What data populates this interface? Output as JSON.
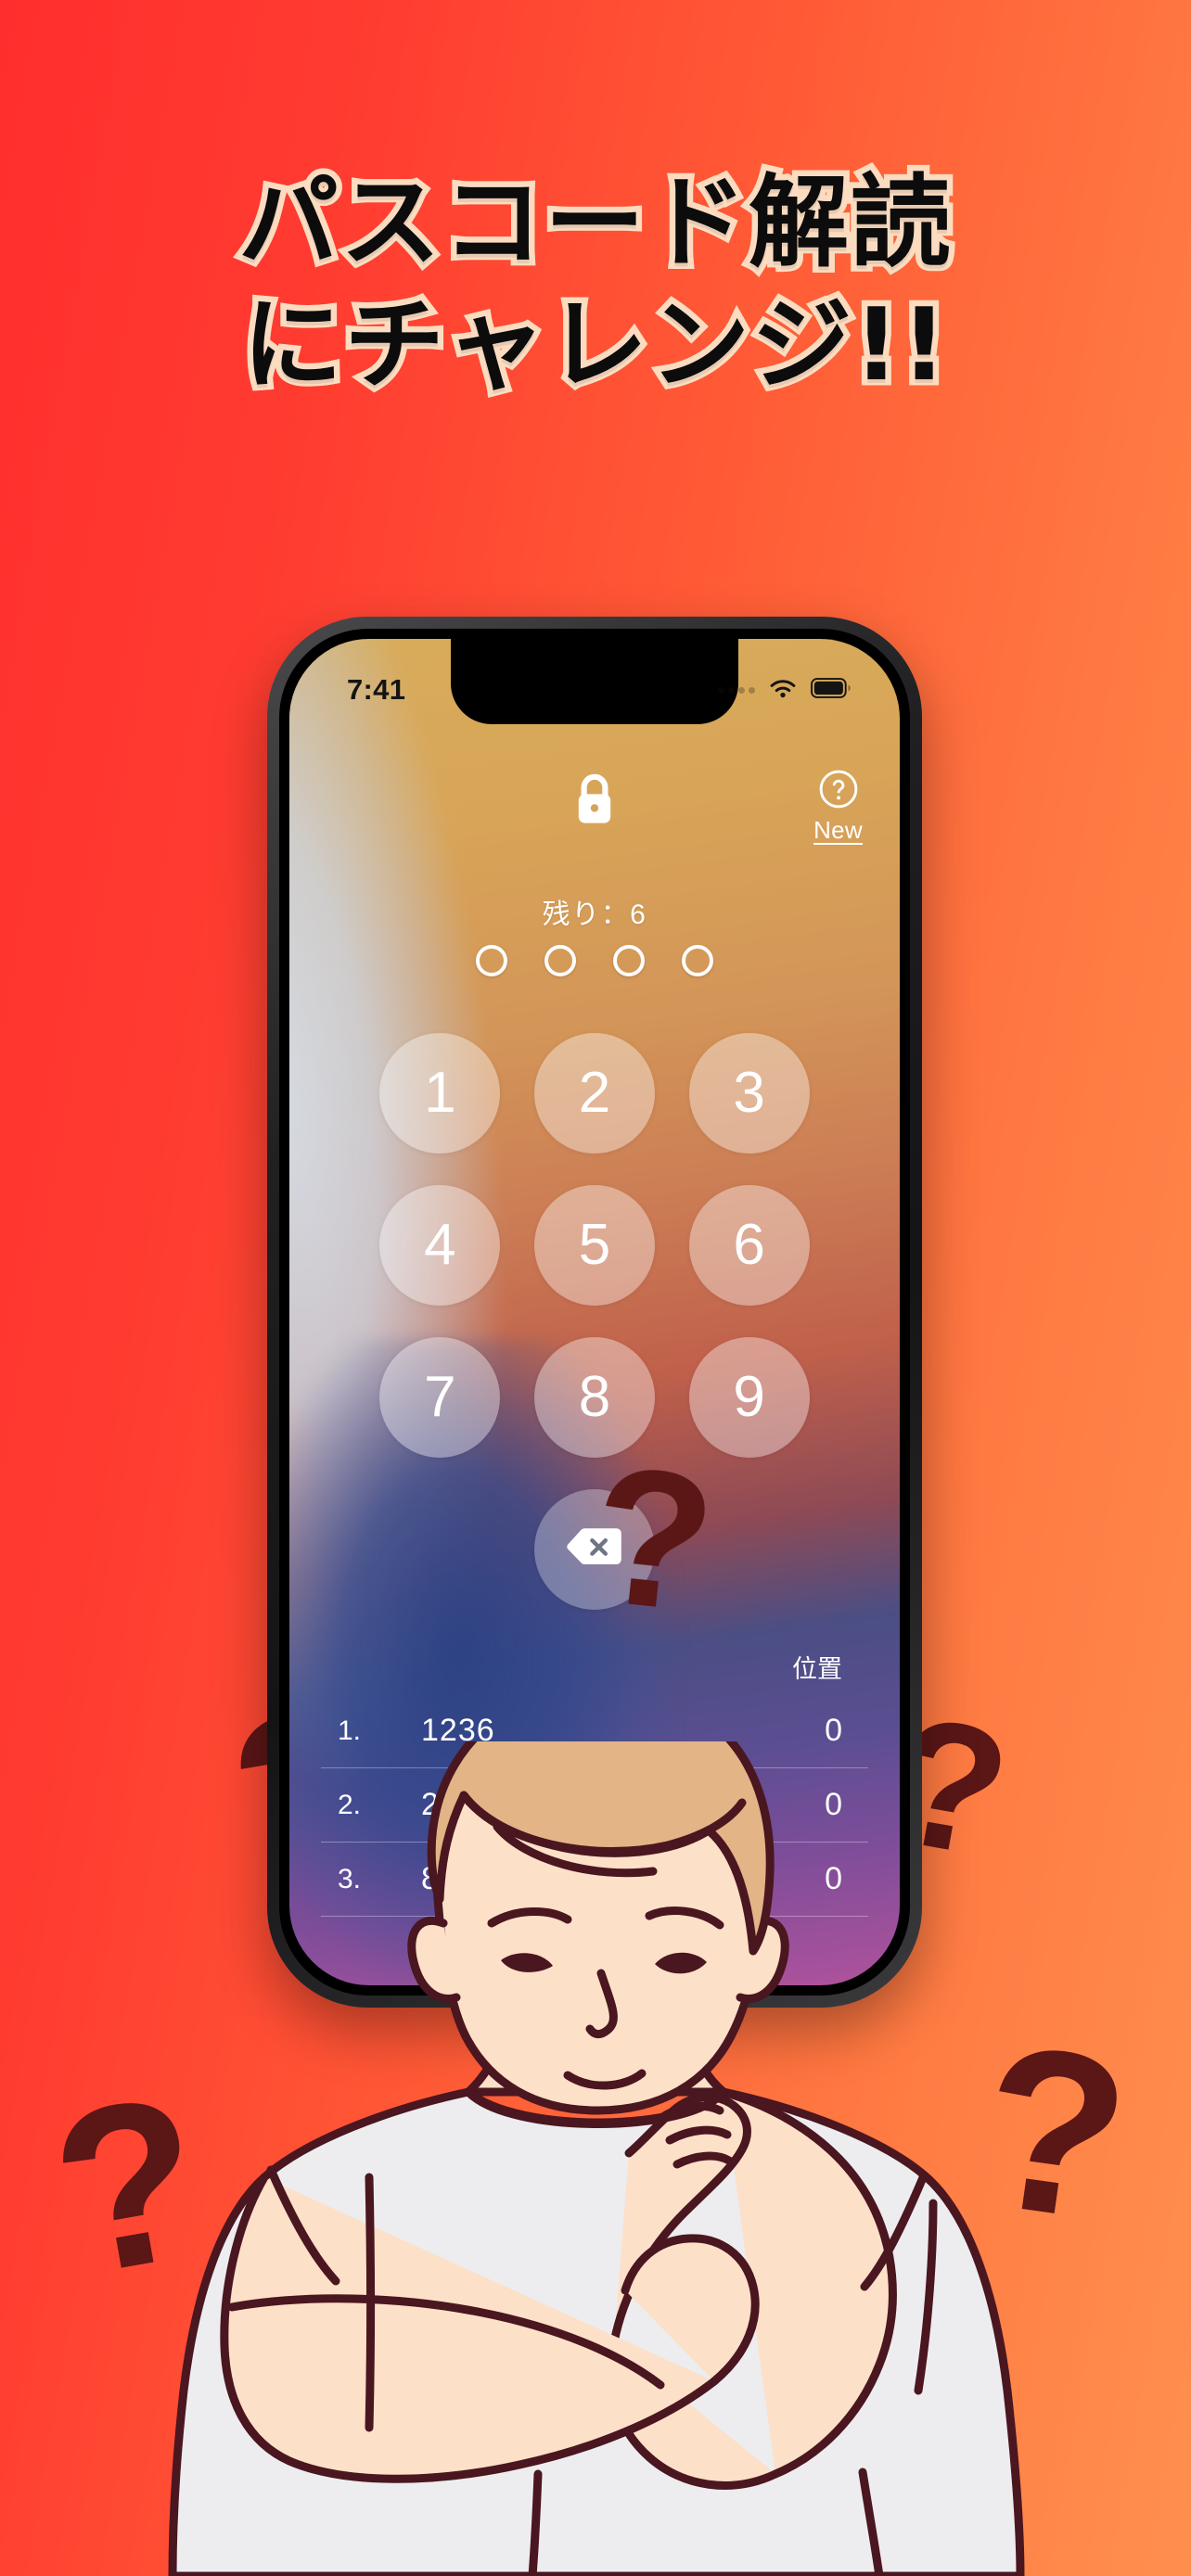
{
  "background": {
    "gradient_from": "#FF2E2E",
    "gradient_to": "#FF8F4F",
    "question_mark": "?",
    "question_mark_color": "#5B1616"
  },
  "headline": {
    "line1": "パスコード解読",
    "line2": "にチャレンジ!!",
    "text_color": "#0C0C0C",
    "outline_color": "#FBDCC0"
  },
  "phone": {
    "status_bar": {
      "time": "7:41",
      "signal_icon": "signal-dots-icon",
      "wifi_icon": "wifi-icon",
      "battery_icon": "battery-icon"
    },
    "lock_icon": "lock-icon",
    "help": {
      "icon": "question-circle-icon",
      "label": "New"
    },
    "remaining_label": "残り：6",
    "passcode_dots": 4,
    "keypad": [
      {
        "key": "1"
      },
      {
        "key": "2"
      },
      {
        "key": "3"
      },
      {
        "key": "4"
      },
      {
        "key": "5"
      },
      {
        "key": "6"
      },
      {
        "key": "7"
      },
      {
        "key": "8"
      },
      {
        "key": "9"
      }
    ],
    "delete_icon": "backspace-delete-icon",
    "list": {
      "header_right": "位置",
      "rows": [
        {
          "index": "1.",
          "code": "1236",
          "position": "0"
        },
        {
          "index": "2.",
          "code": "2145",
          "position": "0"
        },
        {
          "index": "3.",
          "code": "8745",
          "position": "0"
        }
      ]
    },
    "home_indicator": "home-indicator"
  },
  "illustration": {
    "name": "thinking-man-illustration",
    "skin": "#FCE0C8",
    "hair": "#E2B486",
    "shirt": "#EDEDEF",
    "outline": "#4A1620"
  }
}
